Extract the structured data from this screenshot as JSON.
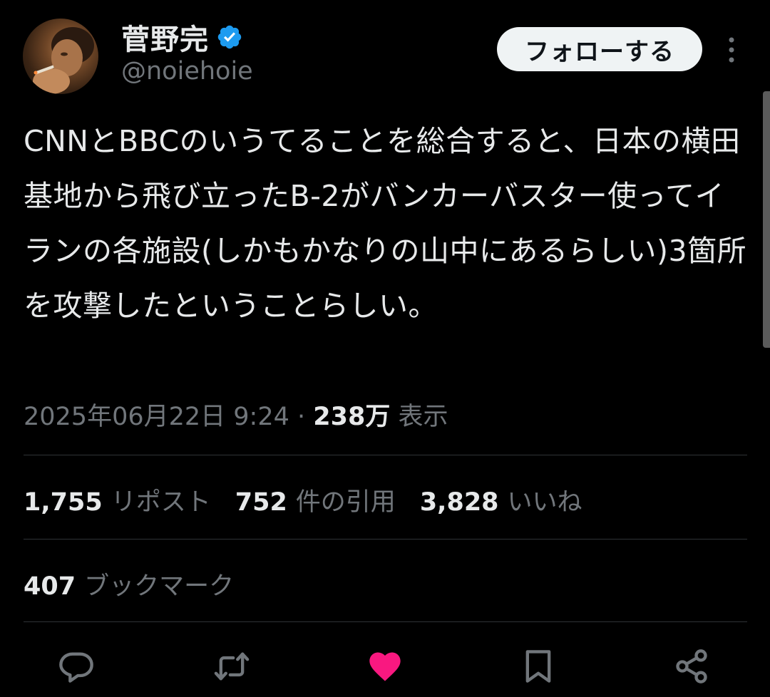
{
  "user": {
    "display_name": "菅野完",
    "handle": "@noiehoie",
    "verified": true
  },
  "follow_button": {
    "label": "フォローする"
  },
  "tweet": {
    "text": "CNNとBBCのいうてることを総合すると、日本の横田基地から飛び立ったB-2がバンカーバスター使ってイランの各施設(しかもかなりの山中にあるらしい)3箇所を攻撃したということらしい。",
    "timestamp": "2025年06月22日 9:24",
    "separator": "·",
    "views_count": "238万",
    "views_label": "表示"
  },
  "stats": {
    "reposts": {
      "count": "1,755",
      "label": "リポスト"
    },
    "quotes": {
      "count": "752",
      "label": "件の引用"
    },
    "likes": {
      "count": "3,828",
      "label": "いいね"
    },
    "bookmarks": {
      "count": "407",
      "label": "ブックマーク"
    }
  },
  "actions": {
    "reply_icon": "speech-bubble-icon",
    "repost_icon": "repost-arrows-icon",
    "like_icon": "heart-icon",
    "like_active": true,
    "bookmark_icon": "bookmark-icon",
    "share_icon": "share-nodes-icon"
  },
  "colors": {
    "background": "#000000",
    "primary_text": "#e7e9ea",
    "secondary_text": "#71767b",
    "divider": "#2f3336",
    "verified_blue": "#1d9bf0",
    "like_pink": "#f91880",
    "follow_bg": "#eff3f4"
  }
}
